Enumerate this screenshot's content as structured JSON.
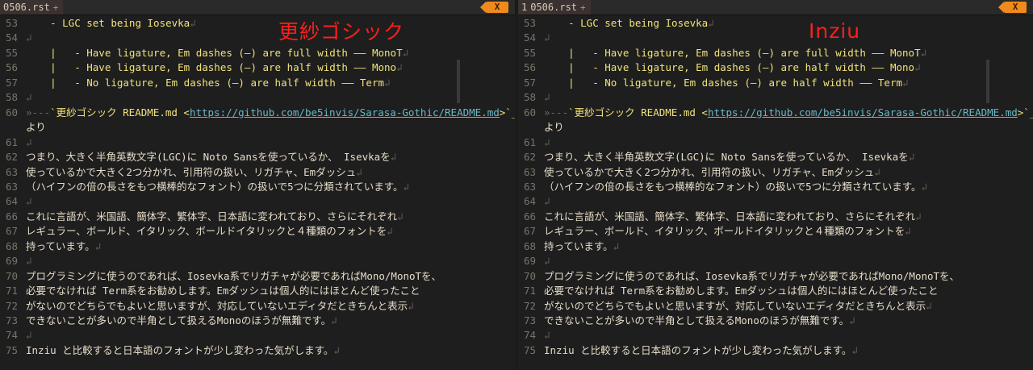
{
  "left": {
    "tab_label": "0506.rst",
    "tab_plus": "+",
    "tab_number": "",
    "close_label": "X",
    "overlay_title": "更紗ゴシック"
  },
  "right": {
    "tab_label": "0506.rst",
    "tab_plus": "+",
    "tab_number": "1",
    "close_label": "X",
    "overlay_title": "Inziu"
  },
  "lines": [
    {
      "n": "53",
      "segments": [
        {
          "t": "    - LGC set being Iosevka",
          "c": "listing"
        },
        {
          "t": "↲",
          "c": "ret"
        }
      ]
    },
    {
      "n": "54",
      "segments": [
        {
          "t": "↲",
          "c": "ret"
        }
      ]
    },
    {
      "n": "55",
      "segments": [
        {
          "t": "    |   - Have ligature, Em dashes (—) are full width —— MonoT",
          "c": "listing"
        },
        {
          "t": "↲",
          "c": "ret"
        }
      ]
    },
    {
      "n": "56",
      "segments": [
        {
          "t": "    |   - Have ligature, Em dashes (—) are half width —— Mono",
          "c": "listing"
        },
        {
          "t": "↲",
          "c": "ret"
        }
      ]
    },
    {
      "n": "57",
      "segments": [
        {
          "t": "    |   - No ligature, Em dashes (—) are half width —— Term",
          "c": "listing"
        },
        {
          "t": "↲",
          "c": "ret"
        }
      ]
    },
    {
      "n": "58",
      "segments": [
        {
          "t": "↲",
          "c": "ret"
        }
      ]
    },
    {
      "n": "60",
      "segments": [
        {
          "t": "»---",
          "c": "tabmark"
        },
        {
          "t": "`更紗ゴシック README.md <",
          "c": "listing"
        },
        {
          "t": "https://github.com/be5invis/Sarasa-Gothic/README.md",
          "c": "link"
        },
        {
          "t": ">`_",
          "c": "listing"
        }
      ]
    },
    {
      "n": "",
      "segments": [
        {
          "t": "より",
          "c": "title-ja"
        }
      ]
    },
    {
      "n": "61",
      "segments": [
        {
          "t": "↲",
          "c": "ret"
        }
      ]
    },
    {
      "n": "62",
      "segments": [
        {
          "t": "つまり、大きく半角英数文字(LGC)に Noto Sansを使っているか、 Isevkaを",
          "c": "title-ja"
        },
        {
          "t": "↲",
          "c": "ret"
        }
      ]
    },
    {
      "n": "63",
      "segments": [
        {
          "t": "使っているかで大きく2つ分かれ、引用符の扱い、リガチャ、Emダッシュ",
          "c": "title-ja"
        },
        {
          "t": "↲",
          "c": "ret"
        }
      ]
    },
    {
      "n": "63",
      "segments": [
        {
          "t": "（ハイフンの倍の長さをもつ横棒的なフォント）の扱いで5つに分類されています。",
          "c": "title-ja"
        },
        {
          "t": "↲",
          "c": "ret"
        }
      ]
    },
    {
      "n": "64",
      "segments": [
        {
          "t": "↲",
          "c": "ret"
        }
      ]
    },
    {
      "n": "66",
      "segments": [
        {
          "t": "これに言語が、米国語、簡体字、繁体字、日本語に変われており、さらにそれぞれ",
          "c": "title-ja"
        },
        {
          "t": "↲",
          "c": "ret"
        }
      ]
    },
    {
      "n": "67",
      "segments": [
        {
          "t": "レギュラー、ボールド、イタリック、ボールドイタリックと４種類のフォントを",
          "c": "title-ja"
        },
        {
          "t": "↲",
          "c": "ret"
        }
      ]
    },
    {
      "n": "68",
      "segments": [
        {
          "t": "持っています。",
          "c": "title-ja"
        },
        {
          "t": "↲",
          "c": "ret"
        }
      ]
    },
    {
      "n": "69",
      "segments": [
        {
          "t": "↲",
          "c": "ret"
        }
      ]
    },
    {
      "n": "70",
      "segments": [
        {
          "t": "プログラミングに使うのであれば、Iosevka系でリガチャが必要であればMono/MonoTを、",
          "c": "title-ja"
        }
      ]
    },
    {
      "n": "71",
      "segments": [
        {
          "t": "必要でなければ Term系をお勧めします。Emダッシュは個人的にはほとんど使ったこと",
          "c": "title-ja"
        }
      ]
    },
    {
      "n": "72",
      "segments": [
        {
          "t": "がないのでどちらでもよいと思いますが、対応していないエディタだときちんと表示",
          "c": "title-ja"
        },
        {
          "t": "↲",
          "c": "ret"
        }
      ]
    },
    {
      "n": "73",
      "segments": [
        {
          "t": "できないことが多いので半角として扱えるMonoのほうが無難です。",
          "c": "title-ja"
        },
        {
          "t": "↲",
          "c": "ret"
        }
      ]
    },
    {
      "n": "74",
      "segments": [
        {
          "t": "↲",
          "c": "ret"
        }
      ]
    },
    {
      "n": "75",
      "segments": [
        {
          "t": "Inziu と比較すると日本語のフォントが少し変わった気がします。",
          "c": "title-ja"
        },
        {
          "t": "↲",
          "c": "ret"
        }
      ]
    }
  ],
  "colors": {
    "background": "#1e1e1e",
    "listing_yellow": "#f1e27a",
    "link_cyan": "#68b8c8",
    "overlay_red": "#ff1e1e",
    "close_orange": "#f08a1c"
  }
}
